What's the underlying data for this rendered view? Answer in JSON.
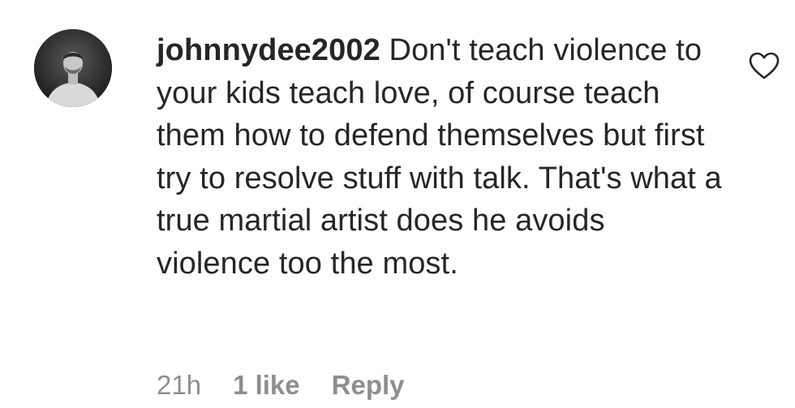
{
  "comment": {
    "avatar_icon": "user-avatar",
    "username": "johnnydee2002",
    "text": "Don't teach violence to your kids teach love, of course teach them how to defend themselves but first try to resolve stuff with talk. That's what a true martial artist does he avoids violence too the most.",
    "like_icon": "heart-outline-icon",
    "meta": {
      "time": "21h",
      "likes": "1 like",
      "reply_label": "Reply"
    }
  },
  "colors": {
    "text": "#262626",
    "meta_text": "#8e8e8e",
    "background": "#ffffff"
  }
}
